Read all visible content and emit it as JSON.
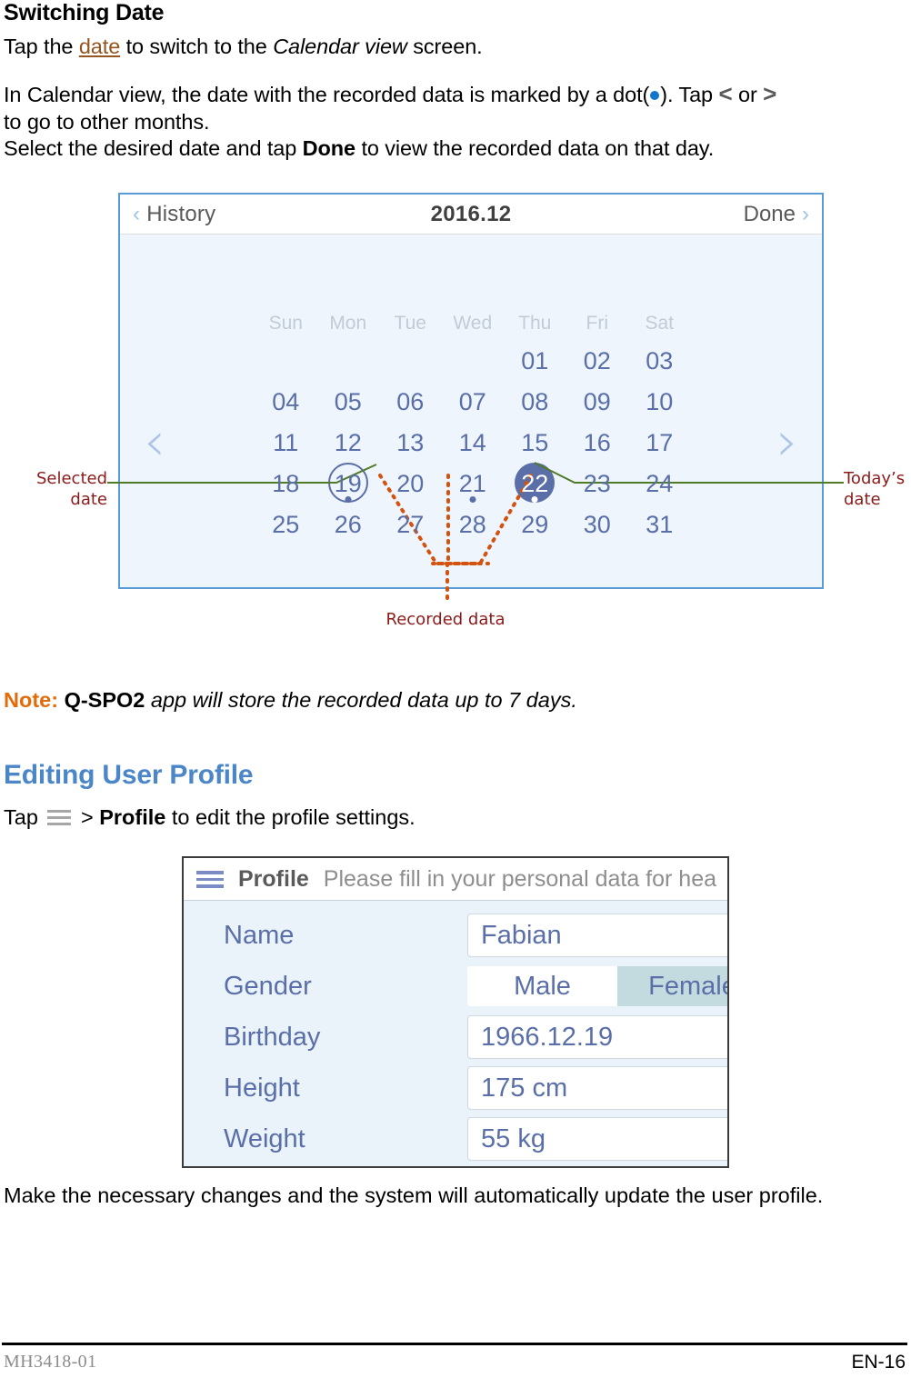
{
  "document": {
    "section_heading": "Switching Date",
    "paragraph_1": {
      "before_link": "Tap the ",
      "link": "date",
      "after_link": " to switch to the ",
      "italic": "Calendar view",
      "tail": " screen."
    },
    "paragraph_2": {
      "part1": "In Calendar view, the date with the recorded data is marked by a dot(",
      "part2": "). Tap ",
      "chev_left": "<",
      "part3": " or ",
      "chev_right": ">",
      "part4": "to go to other months."
    },
    "paragraph_3": {
      "part1": "Select the desired date and tap ",
      "bold": "Done",
      "part2": " to view the recorded data on that day."
    },
    "note": {
      "keyword": "Note:",
      "bold": "Q-SPO2",
      "text": " app will store the recorded data up to 7 days."
    },
    "heading_blue": "Editing User Profile",
    "paragraph_4": {
      "part1": "Tap ",
      "menu_icon": "hamburger-icon",
      "part2": " > ",
      "bold": "Profile",
      "part3": " to edit the profile settings."
    },
    "paragraph_5": "Make the necessary changes and the system will automatically update the user profile."
  },
  "calendar_figure": {
    "topbar": {
      "back_chevron": "‹",
      "back_label": "History",
      "month_title": "2016.12",
      "done_label": "Done",
      "done_chevron": "›"
    },
    "nav": {
      "prev_icon": "‹",
      "next_icon": "›"
    },
    "weekday_headers": [
      "Sun",
      "Mon",
      "Tue",
      "Wed",
      "Thu",
      "Fri",
      "Sat"
    ],
    "weeks": [
      [
        {
          "d": ""
        },
        {
          "d": ""
        },
        {
          "d": ""
        },
        {
          "d": ""
        },
        {
          "d": "01"
        },
        {
          "d": "02"
        },
        {
          "d": "03"
        }
      ],
      [
        {
          "d": "04"
        },
        {
          "d": "05"
        },
        {
          "d": "06"
        },
        {
          "d": "07"
        },
        {
          "d": "08"
        },
        {
          "d": "09"
        },
        {
          "d": "10"
        }
      ],
      [
        {
          "d": "11"
        },
        {
          "d": "12"
        },
        {
          "d": "13"
        },
        {
          "d": "14"
        },
        {
          "d": "15"
        },
        {
          "d": "16"
        },
        {
          "d": "17"
        }
      ],
      [
        {
          "d": "18"
        },
        {
          "d": "19",
          "state": "selected",
          "dot": true
        },
        {
          "d": "20"
        },
        {
          "d": "21",
          "dot": true
        },
        {
          "d": "22",
          "state": "today",
          "dot": true
        },
        {
          "d": "23"
        },
        {
          "d": "24"
        }
      ],
      [
        {
          "d": "25"
        },
        {
          "d": "26"
        },
        {
          "d": "27"
        },
        {
          "d": "28"
        },
        {
          "d": "29"
        },
        {
          "d": "30"
        },
        {
          "d": "31"
        }
      ]
    ],
    "annotations": {
      "selected_date": "Selected\ndate",
      "todays_date": "Today’s\ndate",
      "recorded_data": "Recorded data"
    },
    "colors": {
      "frame_border": "#5b9bd5",
      "panel_bg": "#eef5fc",
      "day_text": "#5a6fa8",
      "today_fill": "#5a6fa8",
      "weekday_header": "#c2cbd6",
      "callout_green": "#4f7a28",
      "callout_orange": "#d4520f",
      "annotation_text": "#8b1a1a"
    }
  },
  "profile_figure": {
    "topbar": {
      "menu_icon": "hamburger-icon",
      "title": "Profile",
      "hint": "Please fill in your personal data for hea"
    },
    "rows": [
      {
        "label": "Name",
        "type": "text",
        "value": "Fabian"
      },
      {
        "label": "Gender",
        "type": "segment",
        "options": [
          "Male",
          "Female"
        ],
        "selected": "Female"
      },
      {
        "label": "Birthday",
        "type": "text",
        "value": "1966.12.19"
      },
      {
        "label": "Height",
        "type": "text",
        "value": "175 cm"
      },
      {
        "label": "Weight",
        "type": "text",
        "value": "55 kg"
      }
    ],
    "colors": {
      "frame_border": "#3b3b3b",
      "panel_bg": "#eaf3fa",
      "label_text": "#5a6fa8",
      "segment_active_bg": "#c3dade"
    }
  },
  "footer": {
    "doc_number": "MH3418-01",
    "page_number": "EN-16"
  }
}
